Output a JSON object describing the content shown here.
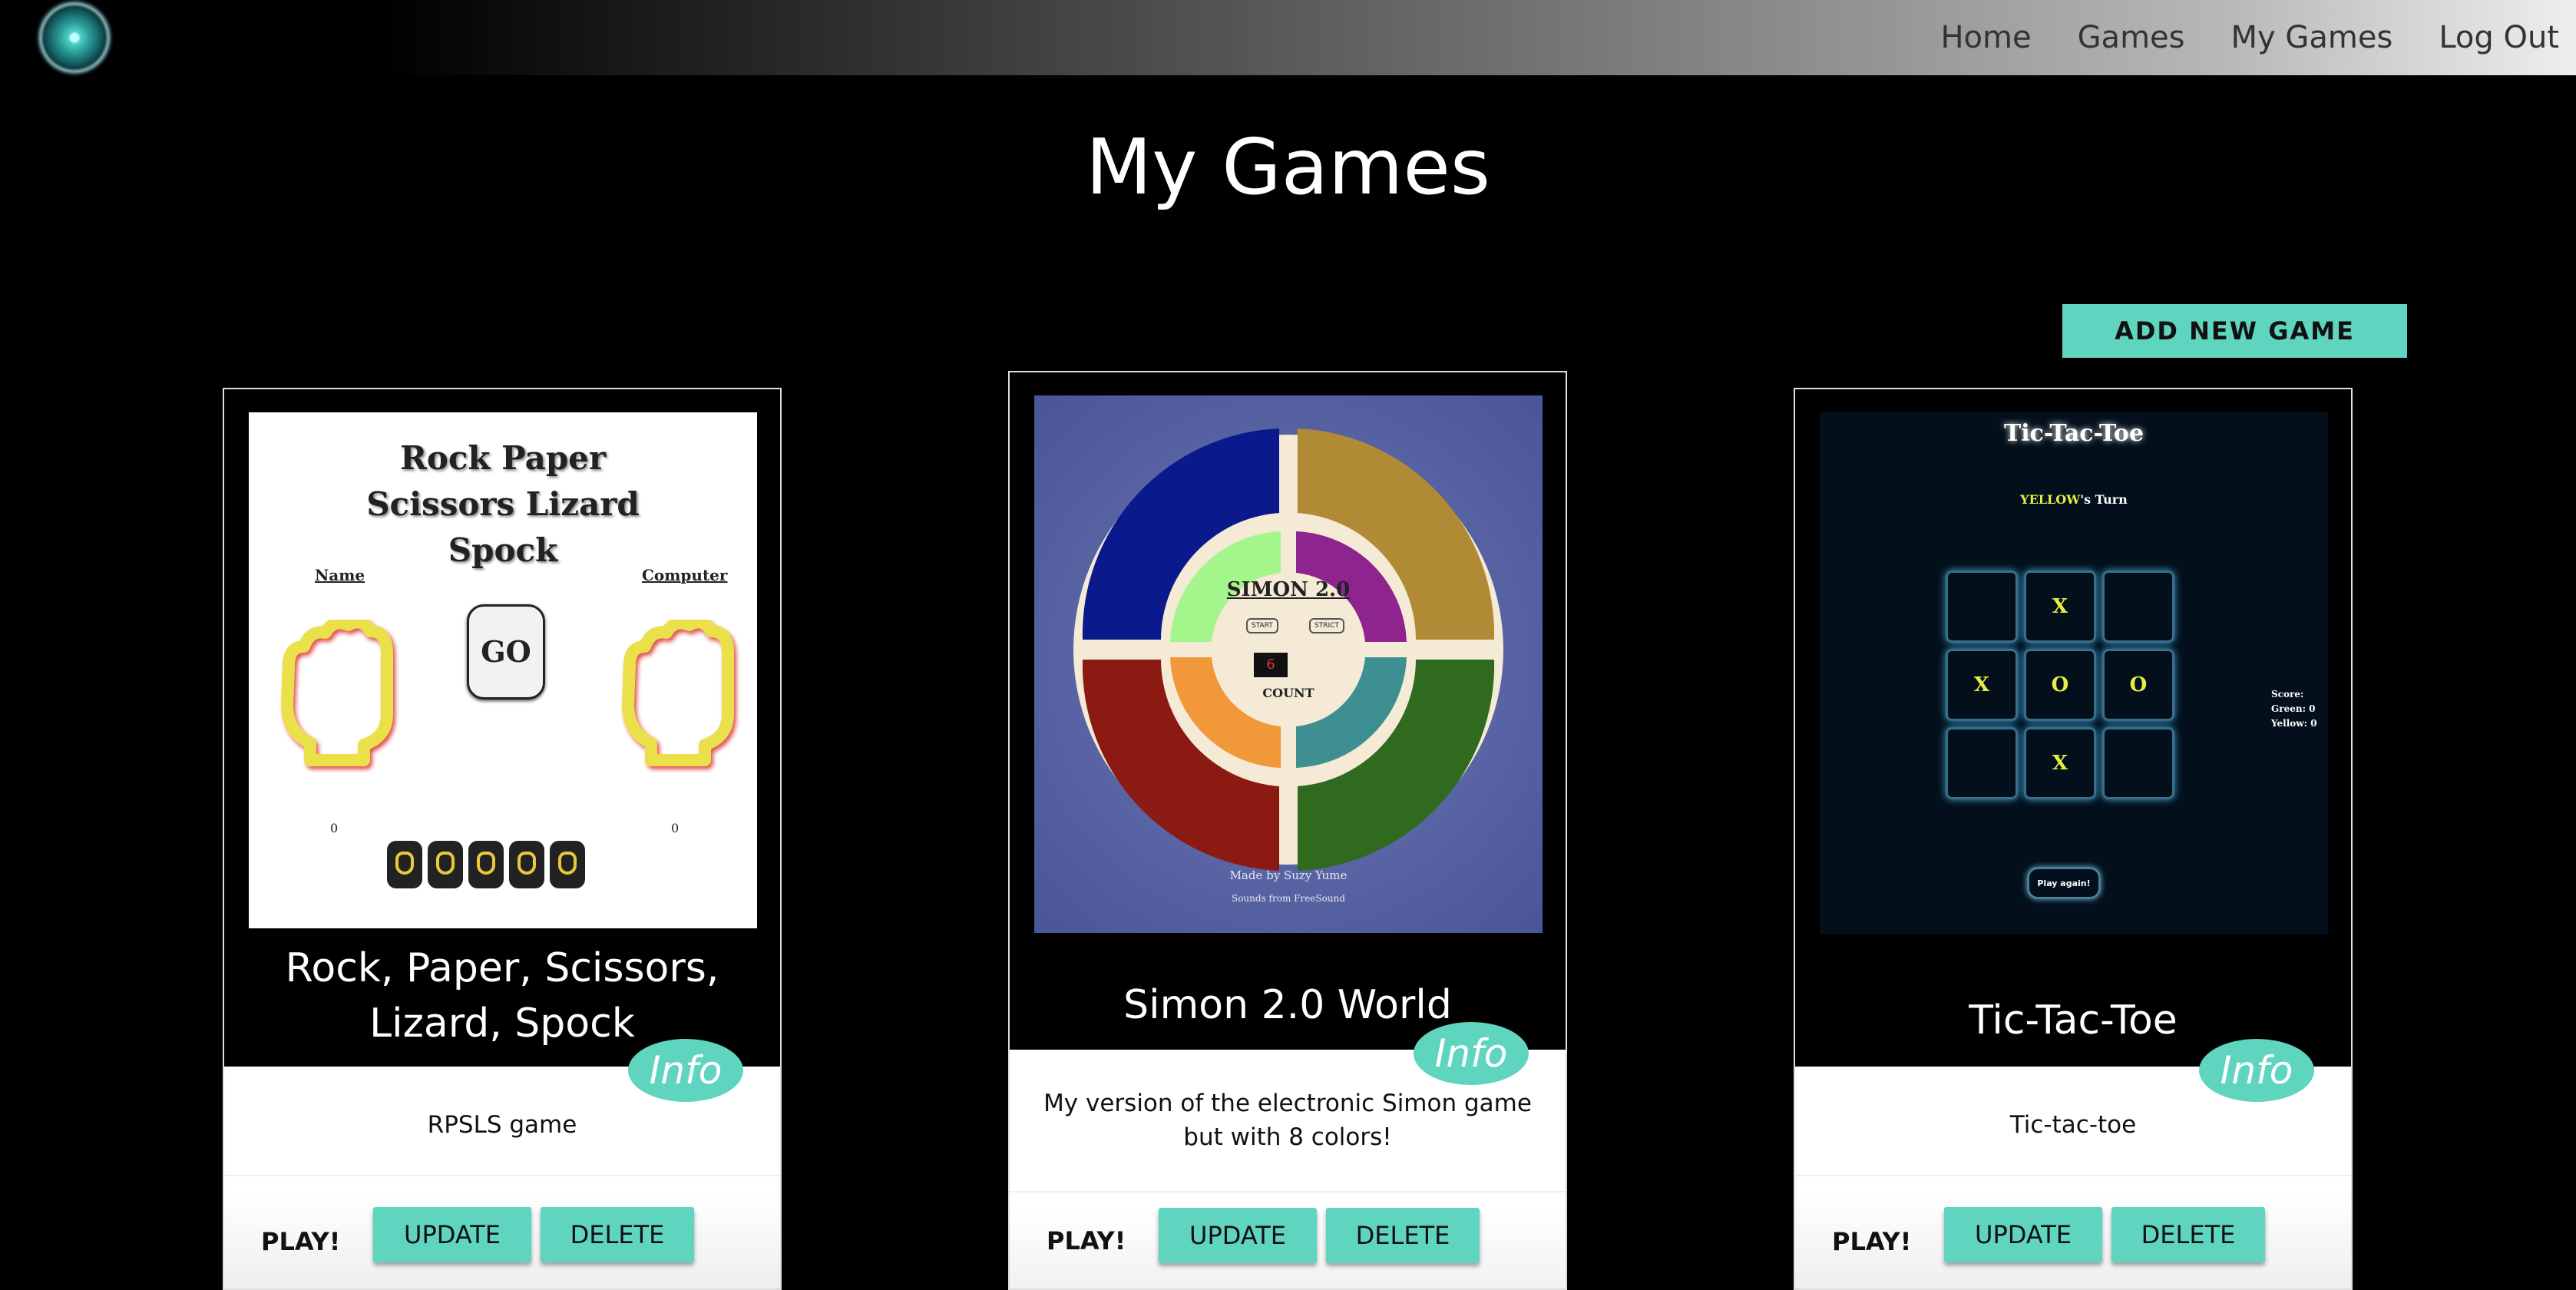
{
  "nav": {
    "links": [
      "Home",
      "Games",
      "My Games",
      "Log Out"
    ]
  },
  "page": {
    "title": "My Games",
    "add_button": "ADD NEW GAME"
  },
  "cards": [
    {
      "title": "Rock, Paper, Scissors, Lizard, Spock",
      "info": "Info",
      "description": "RPSLS game",
      "play": "PLAY!",
      "update": "UPDATE",
      "delete": "DELETE",
      "thumb": {
        "title": "Rock Paper Scissors Lizard Spock",
        "player_label": "Name",
        "computer_label": "Computer",
        "go": "GO",
        "player_score": "0",
        "computer_score": "0"
      }
    },
    {
      "title": "Simon 2.0 World",
      "info": "Info",
      "description": "My version of the electronic Simon game but with 8 colors!",
      "play": "PLAY!",
      "update": "UPDATE",
      "delete": "DELETE",
      "thumb": {
        "name": "SIMON 2.0",
        "start": "START",
        "strict": "STRICT",
        "count_value": "6",
        "count_label": "COUNT",
        "credit": "Made by Suzy Yume",
        "sounds": "Sounds from FreeSound"
      }
    },
    {
      "title": "Tic-Tac-Toe",
      "info": "Info",
      "description": "Tic-tac-toe",
      "play": "PLAY!",
      "update": "UPDATE",
      "delete": "DELETE",
      "thumb": {
        "title": "Tic-Tac-Toe",
        "turn_player": "YELLOW",
        "turn_suffix": "'s Turn",
        "board": [
          "",
          "X",
          "",
          "X",
          "O",
          "O",
          "",
          "X",
          ""
        ],
        "score_label": "Score:",
        "green_score": "Green: 0",
        "yellow_score": "Yellow: 0",
        "play_again": "Play again!"
      }
    }
  ],
  "colors": {
    "accent": "#5fd5c0",
    "background": "#000000"
  }
}
